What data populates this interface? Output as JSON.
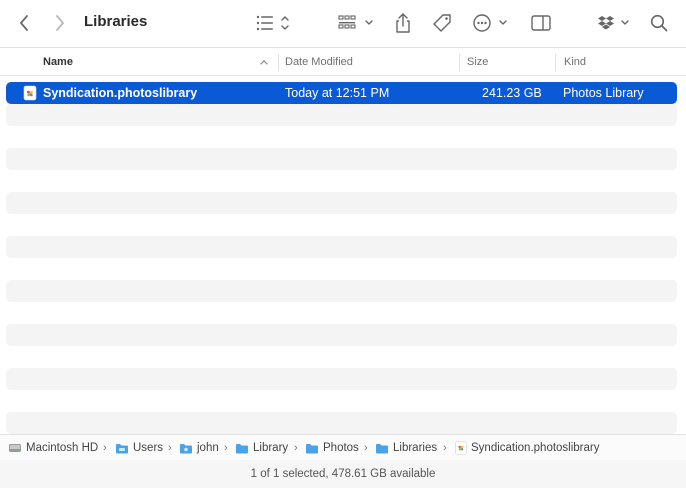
{
  "window": {
    "title": "Libraries"
  },
  "toolbar": {
    "back": "chevron-left-icon",
    "forward": "chevron-right-icon",
    "view_list": "list-view-icon",
    "group": "grid-group-icon",
    "share": "share-icon",
    "tag": "tag-icon",
    "more": "ellipsis-circle-icon",
    "preview": "sidebar-right-icon",
    "dropbox": "dropbox-icon",
    "search": "search-icon"
  },
  "columns": {
    "name": "Name",
    "date": "Date Modified",
    "size": "Size",
    "kind": "Kind"
  },
  "files": [
    {
      "name": "Syndication.photoslibrary",
      "date": "Today at 12:51 PM",
      "size": "241.23 GB",
      "kind": "Photos Library",
      "selected": true
    }
  ],
  "path": [
    {
      "label": "Macintosh HD",
      "icon": "hard-drive-icon"
    },
    {
      "label": "Users",
      "icon": "folder-icon"
    },
    {
      "label": "john",
      "icon": "folder-icon"
    },
    {
      "label": "Library",
      "icon": "folder-icon"
    },
    {
      "label": "Photos",
      "icon": "folder-icon"
    },
    {
      "label": "Libraries",
      "icon": "folder-icon"
    },
    {
      "label": "Syndication.photoslibrary",
      "icon": "photos-library-icon"
    }
  ],
  "status": {
    "text": "1 of 1 selected, 478.61 GB available"
  },
  "colors": {
    "selection": "#0a5ad6",
    "folder": "#4aa3e8",
    "stripe": "#f4f4f4"
  }
}
